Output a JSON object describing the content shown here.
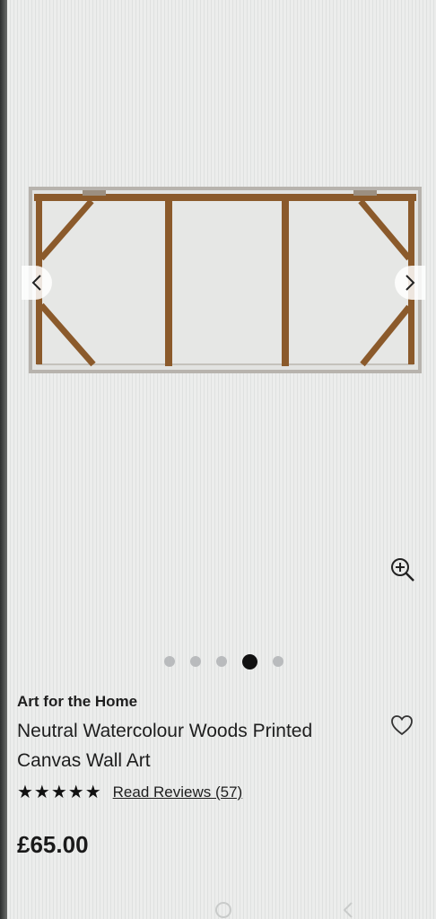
{
  "gallery": {
    "image_alt": "Back of canvas frame",
    "prev_icon": "chevron-left-icon",
    "next_icon": "chevron-right-icon",
    "zoom_icon": "zoom-in-icon",
    "slide_count": 5,
    "active_slide": 4
  },
  "product": {
    "brand": "Art for the Home",
    "title": "Neutral Watercolour Woods Printed Canvas Wall Art",
    "stars": "★★★★★",
    "rating": 5,
    "reviews_label": "Read Reviews (57)",
    "price": "£65.00",
    "wishlist_icon": "heart-outline-icon"
  },
  "colors": {
    "background": "#ecedec",
    "text": "#1e1e1e",
    "dot_inactive": "#b9bbbd",
    "dot_active": "#111111",
    "frame_wood": "#8b5a2b"
  }
}
